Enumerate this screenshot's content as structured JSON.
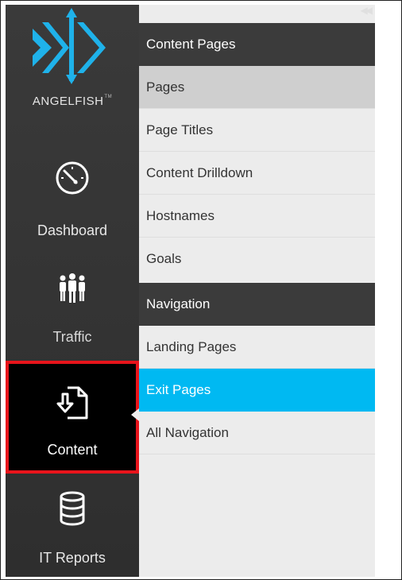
{
  "brand": {
    "name": "ANGELFISH",
    "trademark": "TM"
  },
  "sidebar": {
    "items": [
      {
        "label": "Dashboard",
        "icon": "speedometer-icon"
      },
      {
        "label": "Traffic",
        "icon": "people-icon"
      },
      {
        "label": "Content",
        "icon": "document-icon",
        "active": true
      },
      {
        "label": "IT Reports",
        "icon": "database-icon"
      }
    ]
  },
  "submenu": {
    "collapse_glyph": "◀◀",
    "sections": [
      {
        "title": "Content Pages",
        "items": [
          "Pages",
          "Page Titles",
          "Content Drilldown",
          "Hostnames",
          "Goals"
        ]
      },
      {
        "title": "Navigation",
        "items": [
          "Landing Pages",
          "Exit Pages",
          "All Navigation"
        ]
      }
    ],
    "selected_item": "Pages",
    "active_item": "Exit Pages"
  },
  "colors": {
    "sidebar_bg": "#333333",
    "header_bg": "#3b3b3b",
    "submenu_bg": "#ececec",
    "active_blue": "#00b9f2",
    "logo_blue": "#1fb2ea",
    "highlight_red": "#e8141b"
  }
}
